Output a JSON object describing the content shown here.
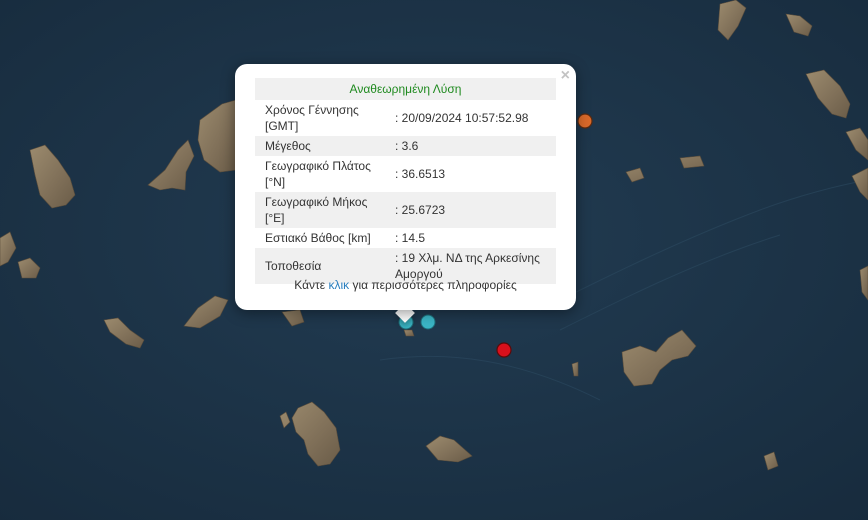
{
  "popup": {
    "title": "Αναθεωρημένη Λύση",
    "close_glyph": "×",
    "rows": [
      {
        "label": "Χρόνος Γέννησης [GMT]",
        "value": ": 20/09/2024 10:57:52.98"
      },
      {
        "label": "Μέγεθος",
        "value": ": 3.6"
      },
      {
        "label": "Γεωγραφικό Πλάτος [°N]",
        "value": ": 36.6513"
      },
      {
        "label": "Γεωγραφικό Μήκος [°E]",
        "value": ": 25.6723"
      },
      {
        "label": "Εστιακό Βάθος [km]",
        "value": ": 14.5"
      },
      {
        "label": "Τοποθεσία",
        "value": ": 19 Χλμ. ΝΔ της Αρκεσίνης Αμοργού"
      }
    ],
    "more_prefix": "Κάντε ",
    "more_link": "κλικ",
    "more_suffix": " για περισσότερες πληροφορίες"
  },
  "colors": {
    "sea": "#1d3449",
    "land": "#8a7a62",
    "marker_cyan": "#3bb6c6",
    "marker_orange": "#d9692a",
    "marker_red": "#d8101c",
    "title_green": "#1f8a1f",
    "link_blue": "#2a7fbf"
  },
  "markers": [
    {
      "name": "quake-marker-selected",
      "color": "cyan"
    },
    {
      "name": "quake-marker-cyan-2",
      "color": "cyan"
    },
    {
      "name": "quake-marker-orange",
      "color": "orange"
    },
    {
      "name": "quake-marker-red",
      "color": "red"
    }
  ]
}
